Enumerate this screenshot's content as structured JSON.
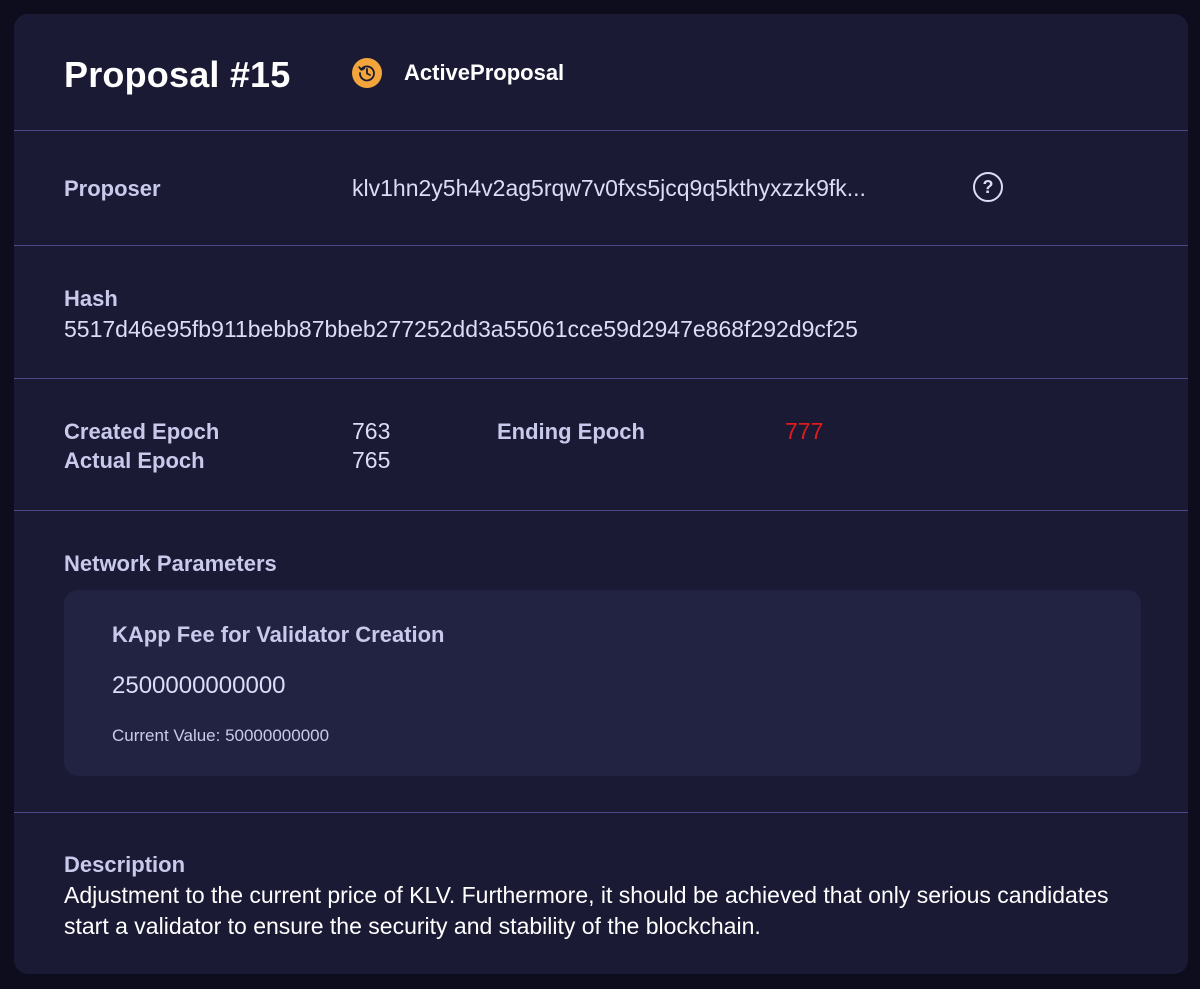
{
  "proposal": {
    "title": "Proposal #15",
    "status_label": "ActiveProposal",
    "status_icon": "history-clock-icon",
    "status_color": "#f3a53c"
  },
  "proposer": {
    "label": "Proposer",
    "value": "klv1hn2y5h4v2ag5rqw7v0fxs5jcq9q5kthyxzzk9fk...",
    "help_icon": "?"
  },
  "hash": {
    "label": "Hash",
    "value": "5517d46e95fb911bebb87bbeb277252dd3a55061cce59d2947e868f292d9cf25"
  },
  "epochs": {
    "created_label": "Created Epoch",
    "created_value": "763",
    "actual_label": "Actual Epoch",
    "actual_value": "765",
    "ending_label": "Ending Epoch",
    "ending_value": "777",
    "ending_color": "#e01b1b"
  },
  "network_parameters": {
    "label": "Network Parameters",
    "items": [
      {
        "name": "KApp Fee for Validator Creation",
        "value": "2500000000000",
        "current": "Current Value: 50000000000"
      }
    ]
  },
  "description": {
    "label": "Description",
    "text": "Adjustment to the current price of KLV. Furthermore, it should be achieved that only serious candidates start a validator to ensure the security and stability of the blockchain."
  }
}
